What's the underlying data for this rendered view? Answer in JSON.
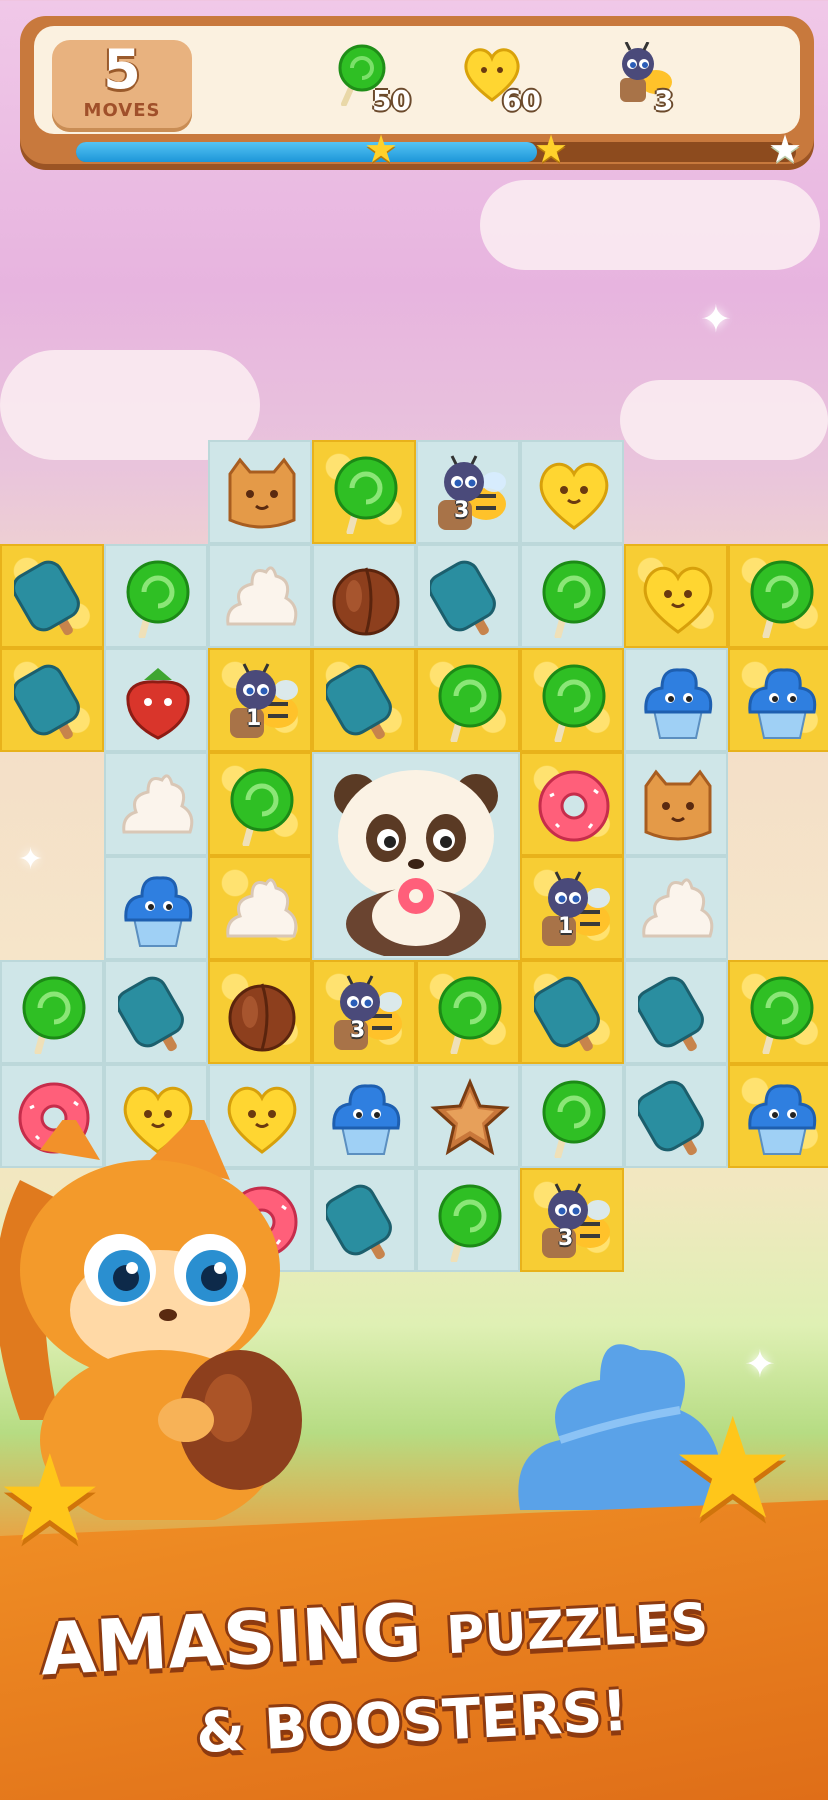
{
  "hud": {
    "moves_count": "5",
    "moves_label": "MOVES",
    "goals": [
      {
        "icon": "green-lollipop-icon",
        "count": "50"
      },
      {
        "icon": "yellow-heart-candy-icon",
        "count": "60"
      },
      {
        "icon": "bee-icon",
        "count": "3"
      }
    ],
    "progress_fraction": 0.64,
    "stars_earned": 2,
    "stars_total": 3
  },
  "board": {
    "rows": [
      [
        null,
        null,
        "cookie",
        "lollipop",
        "bee",
        "heart",
        null,
        null
      ],
      [
        "popsicle",
        "lollipop",
        "cream",
        "nut",
        "popsicle",
        "lollipop",
        "heart",
        "lollipop"
      ],
      [
        "popsicle",
        "strawberry",
        "bee",
        "popsicle",
        "lollipop",
        "lollipop",
        "cupcake",
        "cupcake"
      ],
      [
        null,
        "cream",
        "lollipop",
        "panda",
        "panda",
        "donut",
        "cookie",
        null
      ],
      [
        null,
        "cupcake",
        "cream",
        "panda",
        "panda",
        "bee",
        "cream",
        null
      ],
      [
        "lollipop",
        "popsicle",
        "nut",
        "bee",
        "lollipop",
        "popsicle",
        "popsicle",
        "lollipop"
      ],
      [
        "donut",
        "heart",
        "heart",
        "cupcake",
        "starcookie",
        "lollipop",
        "popsicle",
        "cupcake"
      ],
      [
        null,
        null,
        "donut",
        "popsicle",
        "lollipop",
        "bee",
        null,
        null
      ]
    ],
    "honey_cells": [
      [
        0,
        3
      ],
      [
        1,
        0
      ],
      [
        1,
        6
      ],
      [
        1,
        7
      ],
      [
        2,
        0
      ],
      [
        2,
        2
      ],
      [
        2,
        3
      ],
      [
        2,
        4
      ],
      [
        2,
        5
      ],
      [
        2,
        7
      ],
      [
        3,
        2
      ],
      [
        3,
        5
      ],
      [
        4,
        2
      ],
      [
        4,
        5
      ],
      [
        5,
        2
      ],
      [
        5,
        3
      ],
      [
        5,
        4
      ],
      [
        5,
        5
      ],
      [
        5,
        7
      ],
      [
        6,
        7
      ],
      [
        7,
        5
      ]
    ],
    "bee_numbers": {
      "0-4": "3",
      "2-2": "1",
      "4-5": "1",
      "5-3": "3",
      "7-5": "3"
    }
  },
  "colors": {
    "lollipop": "#2fbf24",
    "heart": "#ffd631",
    "popsicle": "#2a8ea0",
    "cupcake": "#2f7fe0",
    "honey": "#f7cd34",
    "accent_orange": "#e57a1d"
  },
  "tagline": {
    "line1_big": "AMASING",
    "line1_small": "PUZZLES",
    "line2": "& BOOSTERS!"
  }
}
